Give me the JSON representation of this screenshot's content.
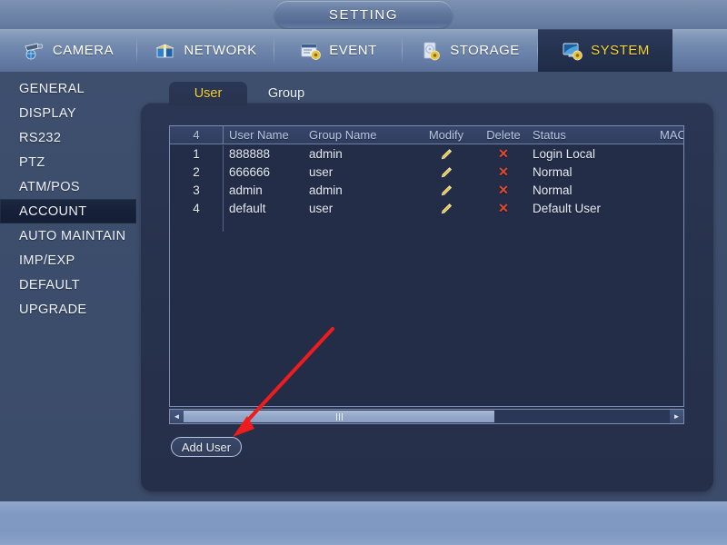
{
  "header": {
    "title": "SETTING"
  },
  "nav": {
    "items": [
      {
        "label": "CAMERA",
        "icon": "camera-icon",
        "active": false
      },
      {
        "label": "NETWORK",
        "icon": "network-icon",
        "active": false
      },
      {
        "label": "EVENT",
        "icon": "event-icon",
        "active": false
      },
      {
        "label": "STORAGE",
        "icon": "storage-icon",
        "active": false
      },
      {
        "label": "SYSTEM",
        "icon": "system-icon",
        "active": true
      }
    ]
  },
  "sidebar": {
    "items": [
      {
        "label": "GENERAL",
        "selected": false
      },
      {
        "label": "DISPLAY",
        "selected": false
      },
      {
        "label": "RS232",
        "selected": false
      },
      {
        "label": "PTZ",
        "selected": false
      },
      {
        "label": "ATM/POS",
        "selected": false
      },
      {
        "label": "ACCOUNT",
        "selected": true
      },
      {
        "label": "AUTO MAINTAIN",
        "selected": false
      },
      {
        "label": "IMP/EXP",
        "selected": false
      },
      {
        "label": "DEFAULT",
        "selected": false
      },
      {
        "label": "UPGRADE",
        "selected": false
      }
    ]
  },
  "tabs": [
    {
      "label": "User",
      "active": true
    },
    {
      "label": "Group",
      "active": false
    }
  ],
  "table": {
    "headers": {
      "count": "4",
      "user_name": "User Name",
      "group_name": "Group Name",
      "modify": "Modify",
      "delete": "Delete",
      "status": "Status",
      "mac_address": "MAC Ad"
    },
    "rows": [
      {
        "index": "1",
        "user_name": "888888",
        "group_name": "admin",
        "modify_icon": "pencil-icon",
        "delete_icon": "x-icon",
        "status": "Login Local",
        "mac_address": ""
      },
      {
        "index": "2",
        "user_name": "666666",
        "group_name": "user",
        "modify_icon": "pencil-icon",
        "delete_icon": "x-icon",
        "status": "Normal",
        "mac_address": ""
      },
      {
        "index": "3",
        "user_name": "admin",
        "group_name": "admin",
        "modify_icon": "pencil-icon",
        "delete_icon": "x-icon",
        "status": "Normal",
        "mac_address": ""
      },
      {
        "index": "4",
        "user_name": "default",
        "group_name": "user",
        "modify_icon": "pencil-icon",
        "delete_icon": "x-icon",
        "status": "Default User",
        "mac_address": ""
      }
    ]
  },
  "scrollbar": {
    "left_arrow": "◄",
    "right_arrow": "►"
  },
  "buttons": {
    "add_user": "Add User"
  },
  "colors": {
    "accent_yellow": "#f5d33a",
    "delete_red": "#e04a2f",
    "modify_gold": "#e8c341",
    "annotation_red": "#ee1c1c",
    "panel_bg": "#27324d",
    "desktop_bg": "#3c4c6b"
  }
}
